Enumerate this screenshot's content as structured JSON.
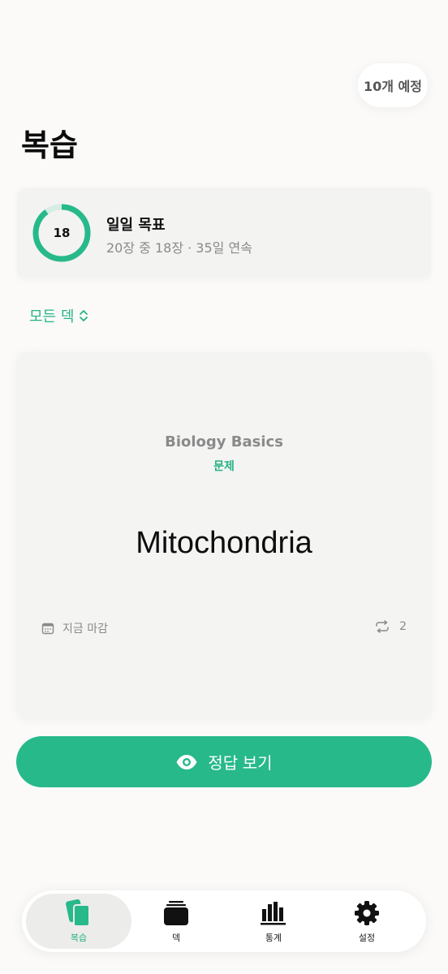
{
  "header": {
    "due_badge": "10개 예정",
    "title": "복습"
  },
  "daily_goal": {
    "title": "일일 목표",
    "done": 18,
    "target": 20,
    "progress": 0.9,
    "ring_label": "18",
    "subtitle": "20장 중 18장 · 35일 연속"
  },
  "deck_selector": {
    "label": "모든 덱"
  },
  "card": {
    "deck_name": "Biology Basics",
    "side_label": "문제",
    "term": "Mitochondria",
    "due_label": "지금 마감",
    "repetitions": "2"
  },
  "reveal_button": {
    "label": "정답 보기"
  },
  "tabs": [
    {
      "label": "복습",
      "icon": "cards-icon",
      "active": true
    },
    {
      "label": "덱",
      "icon": "stack-icon",
      "active": false
    },
    {
      "label": "통계",
      "icon": "bar-chart-icon",
      "active": false
    },
    {
      "label": "설정",
      "icon": "gear-icon",
      "active": false
    }
  ],
  "colors": {
    "accent": "#27b98a",
    "ring_track": "#d6ece4"
  }
}
